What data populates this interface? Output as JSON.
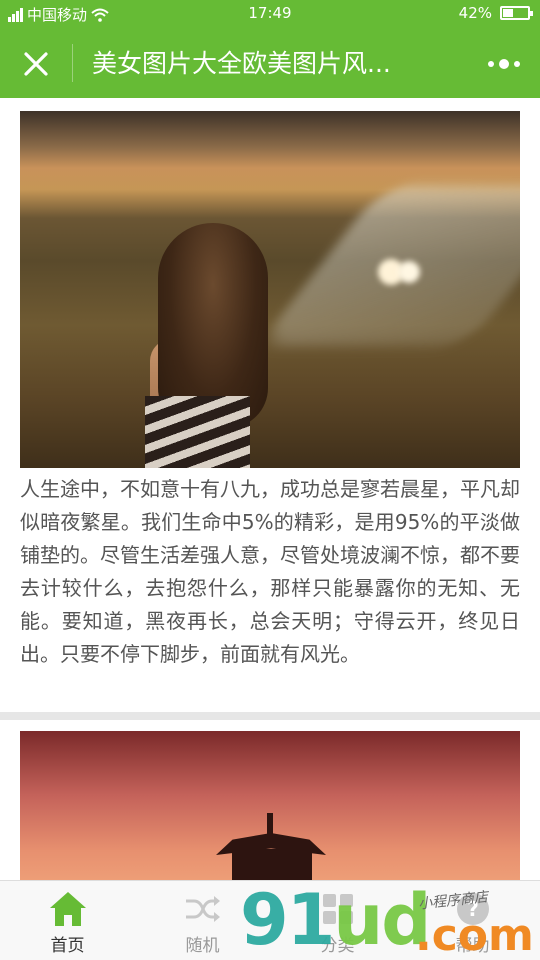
{
  "status_bar": {
    "carrier": "中国移动",
    "time": "17:49",
    "battery_percent": "42%",
    "battery_level": 0.42
  },
  "navbar": {
    "title": "美女图片大全欧美图片风...",
    "close_icon": "close-icon",
    "more_icon": "more-dots-icon"
  },
  "posts": [
    {
      "image": "photo-woman-in-field-at-sunset",
      "text": "人生途中，不如意十有八九，成功总是寥若晨星，平凡却似暗夜繁星。我们生命中5%的精彩，是用95%的平淡做铺垫的。尽管生活差强人意，尽管处境波澜不惊，都不要去计较什么，去抱怨什么，那样只能暴露你的无知、无能。要知道，黑夜再长，总会天明；守得云开，终见日出。只要不停下脚步，前面就有风光。"
    },
    {
      "image": "photo-pagoda-at-sunset"
    }
  ],
  "tabbar": {
    "tabs": [
      {
        "label": "首页",
        "icon": "home-icon",
        "active": true
      },
      {
        "label": "随机",
        "icon": "shuffle-icon",
        "active": false
      },
      {
        "label": "分类",
        "icon": "grid-icon",
        "active": false
      },
      {
        "label": "帮助",
        "icon": "help-icon",
        "active": false
      }
    ]
  },
  "watermark": {
    "digits_g": "91",
    "digits_l": "ud",
    "domain": ".com",
    "tagline": "小程序商店"
  },
  "colors": {
    "brand_green": "#66bb35",
    "text_gray": "#555555",
    "tab_active": "#66bb35",
    "tab_inactive": "#c8c8c8"
  }
}
